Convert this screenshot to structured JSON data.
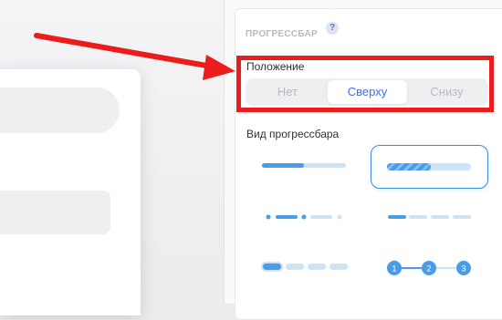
{
  "panel": {
    "section_title": "ПРОГРЕССБАР",
    "help_label": "?",
    "position": {
      "label": "Положение",
      "options": [
        "Нет",
        "Сверху",
        "Снизу"
      ],
      "selected": "Сверху"
    },
    "view": {
      "label": "Вид прогрессбара",
      "selected_index": 1,
      "steps": [
        "1",
        "2",
        "3"
      ]
    }
  },
  "colors": {
    "accent": "#3d6fe0",
    "bar_fill": "#4a9be8",
    "bar_track": "#cfe3f6",
    "highlight": "#ec1c1c"
  }
}
